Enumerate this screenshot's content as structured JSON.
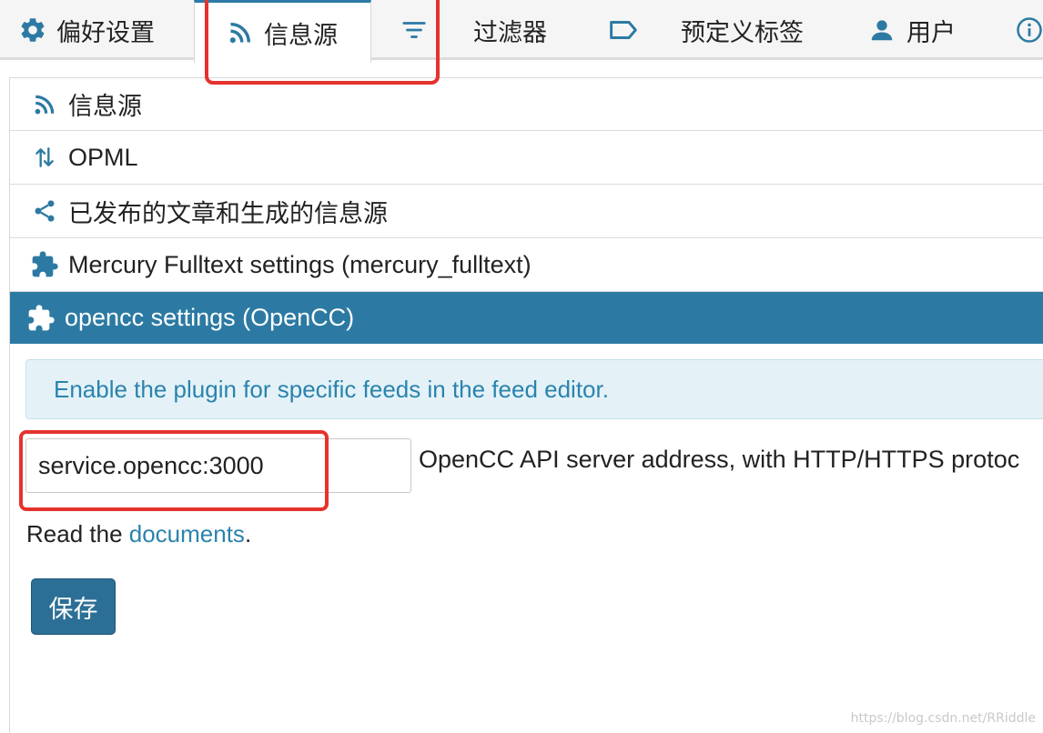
{
  "tabs": {
    "preferences": "偏好设置",
    "feeds": "信息源",
    "filters": "过滤器",
    "labels": "预定义标签",
    "users": "用户"
  },
  "accordion": {
    "feeds": "信息源",
    "opml": "OPML",
    "published": "已发布的文章和生成的信息源",
    "mercury": "Mercury Fulltext settings (mercury_fulltext)",
    "opencc": "opencc settings (OpenCC)"
  },
  "notice": "Enable the plugin for specific feeds in the feed editor.",
  "opencc_field": {
    "value": "service.opencc:3000",
    "help": "OpenCC API server address, with HTTP/HTTPS protoc"
  },
  "read_docs": {
    "prefix": "Read the ",
    "link": "documents",
    "suffix": "."
  },
  "save_label": "保存",
  "watermark": "https://blog.csdn.net/RRiddle",
  "icons": {
    "preferences": "gear-icon",
    "feeds": "rss-icon",
    "filter": "filter-icon",
    "label": "tag-icon",
    "users": "user-icon",
    "info": "info-icon",
    "opml": "sort-arrows-icon",
    "share": "share-icon",
    "plugin": "puzzle-icon"
  },
  "colors": {
    "accent": "#2c7aa3",
    "link": "#2b83ad",
    "notice_bg": "#e4f2f8",
    "highlight": "#e5322d"
  }
}
